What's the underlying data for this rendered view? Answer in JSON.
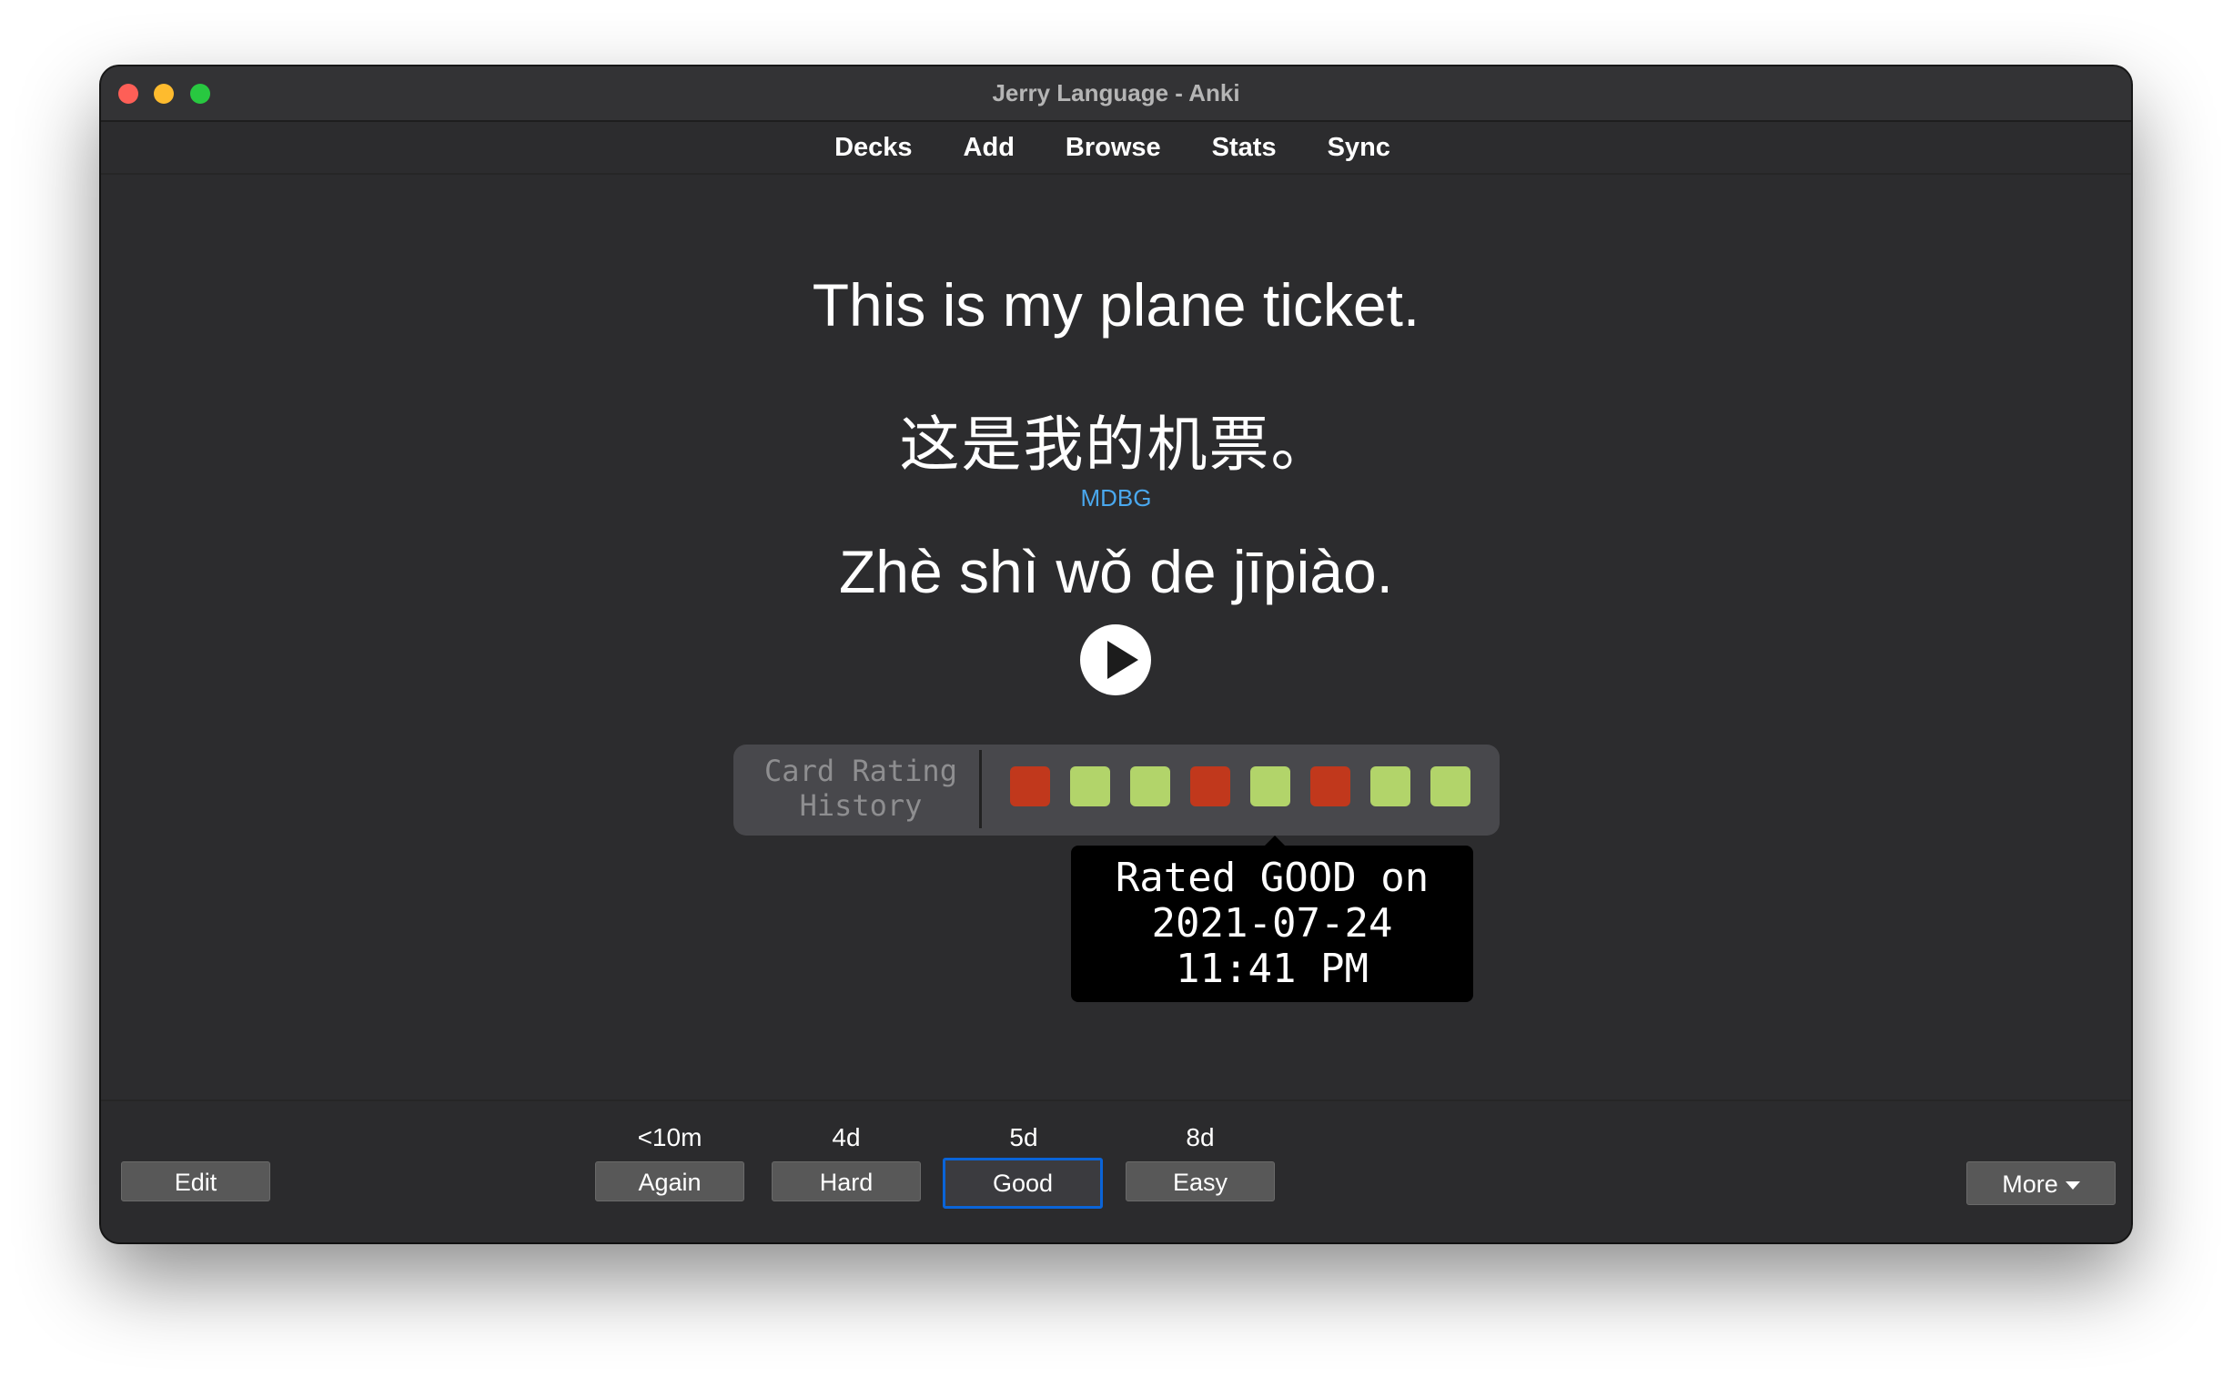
{
  "window": {
    "title": "Jerry Language - Anki"
  },
  "menu": [
    "Decks",
    "Add",
    "Browse",
    "Stats",
    "Sync"
  ],
  "card": {
    "front": "This is my plane ticket.",
    "hanzi": "这是我的机票。",
    "link": "MDBG",
    "pinyin": "Zhè shì wǒ de jīpiào."
  },
  "history": {
    "label_line1": "Card Rating",
    "label_line2": "History",
    "ratings": [
      "again",
      "good",
      "good",
      "again",
      "good",
      "again",
      "good",
      "good"
    ],
    "colors": {
      "again": "#c1381c",
      "good": "#b2d46a"
    }
  },
  "tooltip": {
    "line1": "Rated GOOD on",
    "line2": "2021-07-24",
    "line3": "11:41 PM"
  },
  "answer": {
    "again": {
      "interval": "<10m",
      "label": "Again"
    },
    "hard": {
      "interval": "4d",
      "label": "Hard"
    },
    "good": {
      "interval": "5d",
      "label": "Good"
    },
    "easy": {
      "interval": "8d",
      "label": "Easy"
    }
  },
  "edit_label": "Edit",
  "more_label": "More"
}
